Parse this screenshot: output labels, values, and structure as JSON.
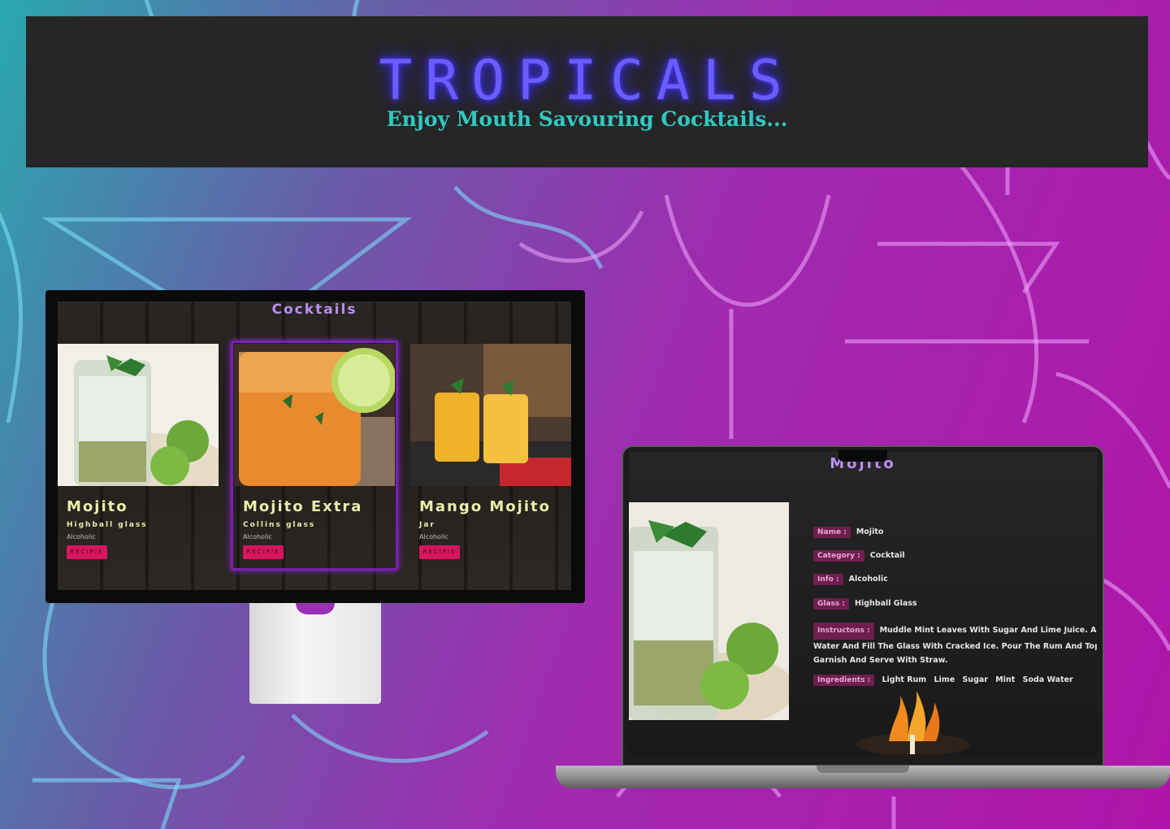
{
  "header": {
    "brand": "TROPICALS",
    "tagline": "Enjoy Mouth Savouring Cocktails..."
  },
  "desktop": {
    "section_title": "Cocktails",
    "cards": [
      {
        "name": "Mojito",
        "glass": "Highball glass",
        "type": "Alcoholic",
        "button": "RECIPIE"
      },
      {
        "name": "Mojito Extra",
        "glass": "Collins glass",
        "type": "Alcoholic",
        "button": "RECIPIE"
      },
      {
        "name": "Mango Mojito",
        "glass": "Jar",
        "type": "Alcoholic",
        "button": "RECIPIE"
      }
    ]
  },
  "laptop": {
    "title": "Mojito",
    "fields": {
      "name_label": "Name :",
      "name_value": "Mojito",
      "category_label": "Category :",
      "category_value": "Cocktail",
      "info_label": "Info :",
      "info_value": "Alcoholic",
      "glass_label": "Glass :",
      "glass_value": "Highball Glass",
      "instructions_label": "Instructons :",
      "instructions_line1": "Muddle Mint Leaves With Sugar And Lime Juice. Add A Spla",
      "instructions_line2": "Water And Fill The Glass With Cracked Ice. Pour The Rum And Top With Soda",
      "instructions_line3": "Garnish And Serve With Straw.",
      "ingredients_label": "Ingredients :",
      "ingredients": [
        "Light Rum",
        "Lime",
        "Sugar",
        "Mint",
        "Soda Water"
      ]
    }
  },
  "colors": {
    "accent_purple": "#b98ff0",
    "brand_neon": "#6a5cff",
    "tagline_teal": "#31c9c1",
    "button_pink": "#d8155f",
    "label_bg": "#6e1f4e"
  }
}
